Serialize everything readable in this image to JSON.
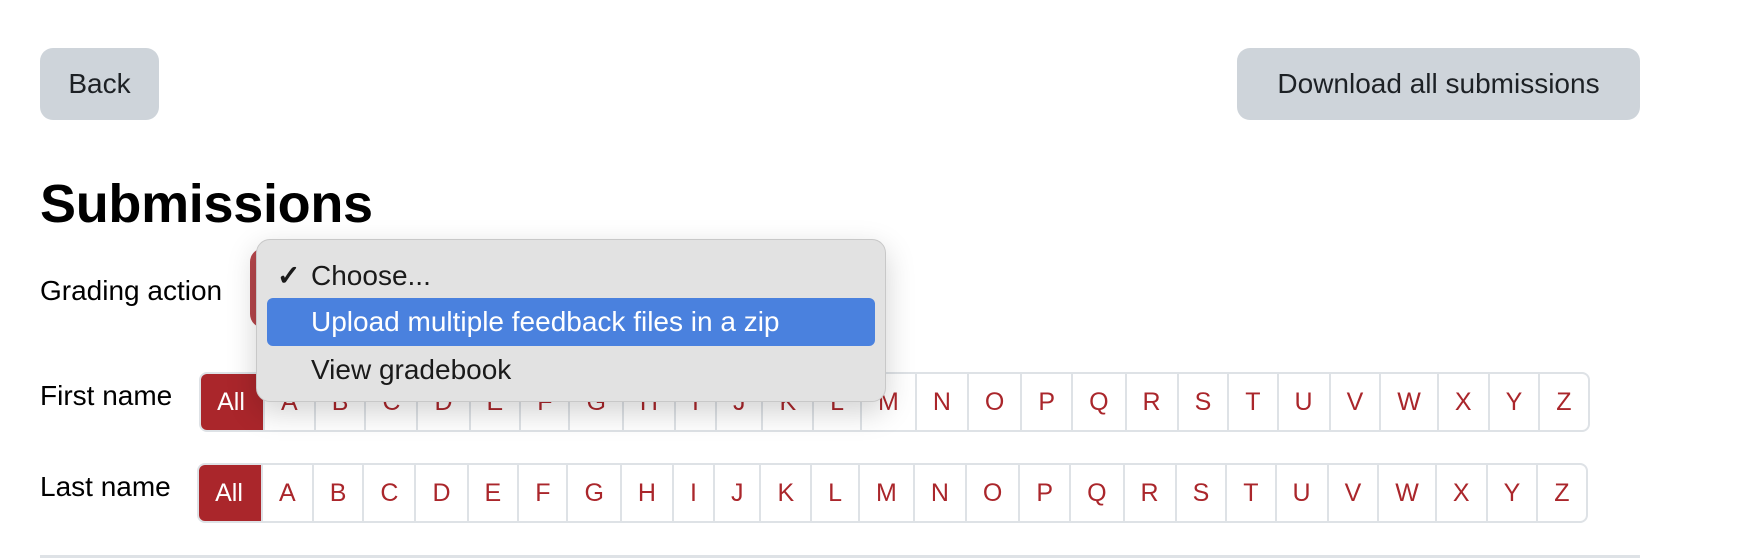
{
  "header": {
    "back_label": "Back",
    "download_label": "Download all submissions"
  },
  "page_title": "Submissions",
  "grading_action": {
    "label": "Grading action",
    "selected": "Choose...",
    "options": [
      {
        "label": "Choose...",
        "checked": true,
        "highlighted": false
      },
      {
        "label": "Upload multiple feedback files in a zip",
        "checked": false,
        "highlighted": true
      },
      {
        "label": "View gradebook",
        "checked": false,
        "highlighted": false
      }
    ],
    "check_icon": "✓"
  },
  "filters": {
    "first_name": {
      "label": "First name",
      "active": "All"
    },
    "last_name": {
      "label": "Last name",
      "active": "All"
    },
    "letters": [
      "All",
      "A",
      "B",
      "C",
      "D",
      "E",
      "F",
      "G",
      "H",
      "I",
      "J",
      "K",
      "L",
      "M",
      "N",
      "O",
      "P",
      "Q",
      "R",
      "S",
      "T",
      "U",
      "V",
      "W",
      "X",
      "Y",
      "Z"
    ]
  },
  "colors": {
    "accent_red": "#aa262b",
    "highlight_blue": "#4a81de",
    "button_gray": "#ced4da"
  }
}
